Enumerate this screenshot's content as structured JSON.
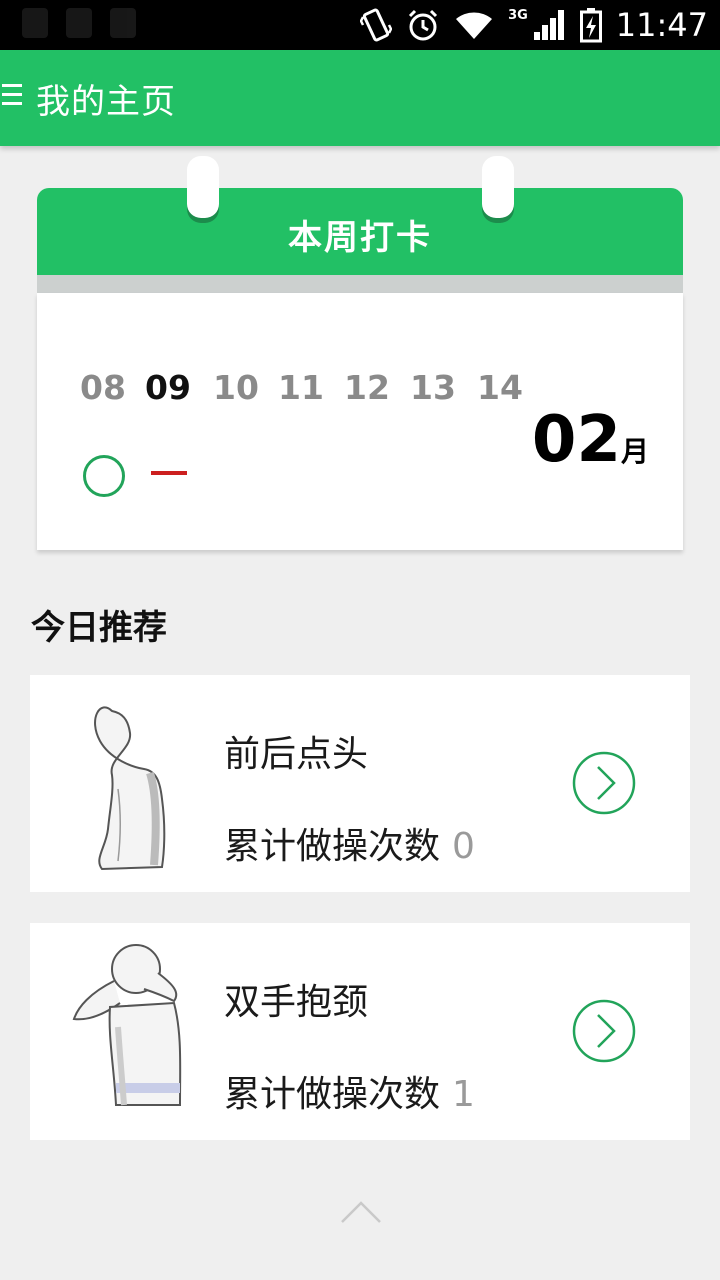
{
  "status_bar": {
    "time": "11:47",
    "network": "3G",
    "icons": [
      "vibrate-icon",
      "alarm-icon",
      "wifi-icon",
      "signal-icon",
      "battery-charging-icon"
    ]
  },
  "app_bar": {
    "title": "我的主页",
    "menu_icon": "menu-icon"
  },
  "weekly_checkin": {
    "title": "本周打卡",
    "days": [
      "08",
      "09",
      "10",
      "11",
      "12",
      "13",
      "14"
    ],
    "today": "09",
    "month_number": "02",
    "month_unit": "月",
    "marks": [
      "checked-circle",
      "missed-dash"
    ],
    "colors": {
      "accent": "#22c065",
      "missed": "#cc1f1f"
    }
  },
  "recommendations": {
    "title": "今日推荐",
    "items": [
      {
        "name": "前后点头",
        "stat_label": "累计做操次数",
        "count": "0",
        "icon": "nodding-figure-icon"
      },
      {
        "name": "双手抱颈",
        "stat_label": "累计做操次数",
        "count": "1",
        "icon": "hands-behind-neck-figure-icon"
      }
    ]
  },
  "scroll_top_icon": "chevron-up-icon"
}
